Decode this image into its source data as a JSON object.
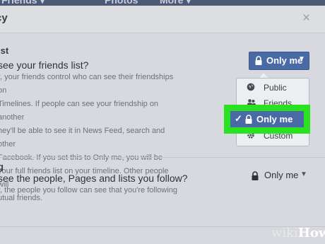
{
  "topnav": {
    "items": [
      "Friends ▾",
      "Photos",
      "More ▾"
    ]
  },
  "dialog": {
    "title": "cy",
    "close": "×",
    "section1": {
      "heading": "ist",
      "question": "see your friends list?",
      "description": "r, your friends control who can see their friendships on\nTimelines. If people can see your friendship on another\nhey'll be able to see it in News Feed, search and other\nFacebook. If you set this to Only me, you will be\nyour full friends list on your timeline. Other people will\nutual friends."
    },
    "section2": {
      "heading": "g",
      "question": "see the people, Pages and lists you follow?",
      "description": "r, the people you follow can see that you're following"
    }
  },
  "audience_button": {
    "label": "Only me",
    "icon": "lock-icon"
  },
  "audience_menu": {
    "items": [
      {
        "label": "Public",
        "icon": "globe-icon"
      },
      {
        "label": "Friends",
        "icon": "friends-icon"
      },
      {
        "label": "Only me",
        "icon": "lock-icon",
        "selected": true
      },
      {
        "label": "Custom",
        "icon": "gear-icon"
      }
    ]
  },
  "follow_selector": {
    "label": "Only me",
    "icon": "lock-icon"
  },
  "watermark": {
    "wiki": "wiki",
    "how": "How"
  },
  "colors": {
    "accent": "#4a6aa6",
    "highlight": "#2ae21f"
  }
}
